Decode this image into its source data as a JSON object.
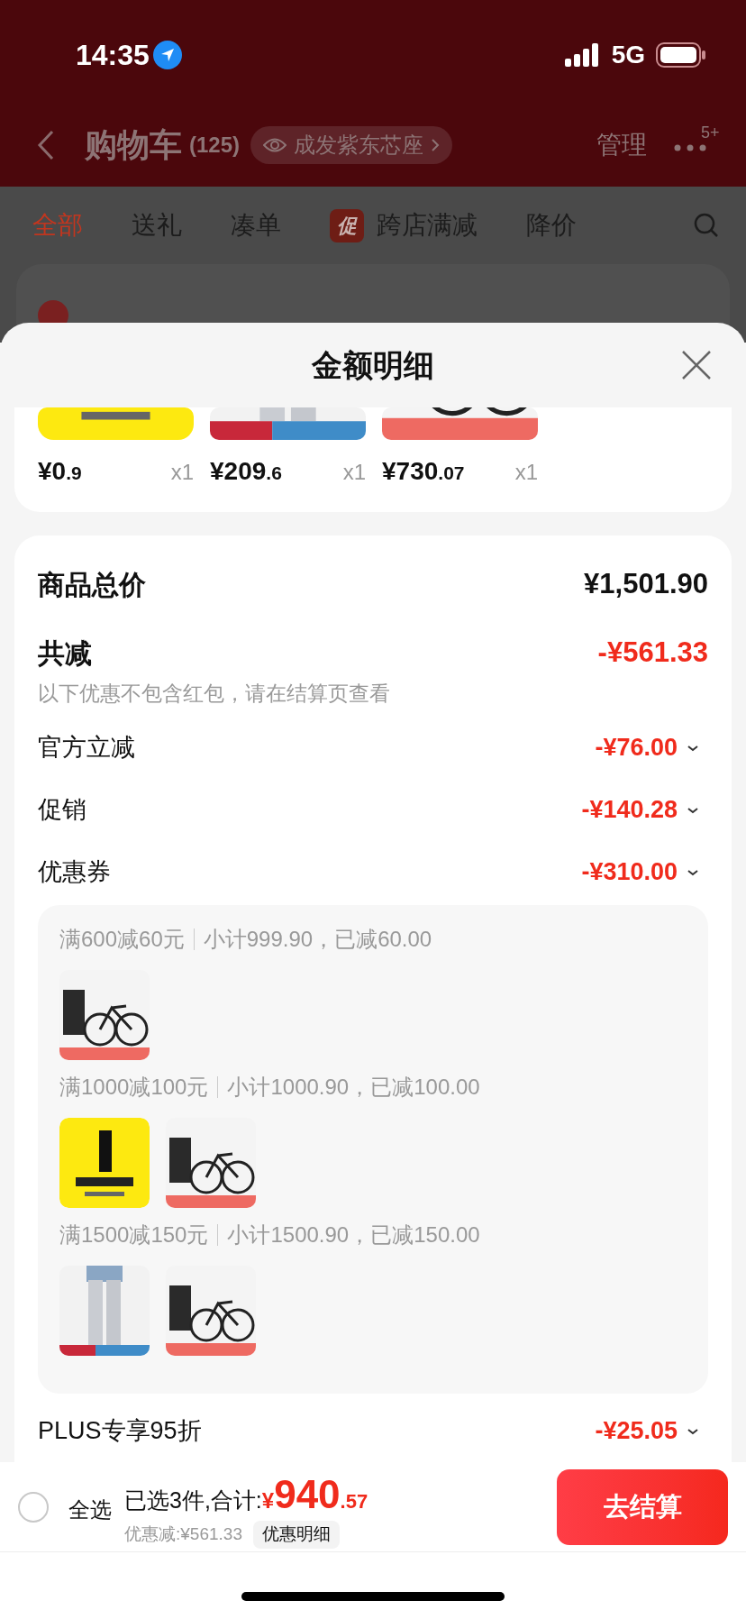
{
  "status_bar": {
    "time": "14:35",
    "network": "5G"
  },
  "nav": {
    "title": "购物车",
    "count": "(125)",
    "location": "成发紫东芯座",
    "manage": "管理",
    "badge": "5+"
  },
  "tabs": [
    {
      "label": "全部",
      "selected": true
    },
    {
      "label": "送礼",
      "selected": false
    },
    {
      "label": "凑单",
      "selected": false
    },
    {
      "label": "跨店满减",
      "selected": false,
      "tag": "促"
    },
    {
      "label": "降价",
      "selected": false
    }
  ],
  "sheet": {
    "title": "金额明细",
    "items": [
      {
        "kind": "postage",
        "currency": "¥",
        "integer": "0",
        "decimal": ".9",
        "qty": "x1"
      },
      {
        "kind": "pants",
        "currency": "¥",
        "integer": "209",
        "decimal": ".6",
        "qty": "x1"
      },
      {
        "kind": "bike",
        "currency": "¥",
        "integer": "730",
        "decimal": ".07",
        "qty": "x1"
      }
    ],
    "total": {
      "label": "商品总价",
      "value": "¥1,501.90"
    },
    "reduction": {
      "label": "共减",
      "value": "-¥561.33",
      "note": "以下优惠不包含红包，请在结算页查看"
    },
    "discounts": [
      {
        "label": "官方立减",
        "value": "-¥76.00"
      },
      {
        "label": "促销",
        "value": "-¥140.28"
      },
      {
        "label": "优惠券",
        "value": "-¥310.00"
      }
    ],
    "coupon_groups": [
      {
        "rule": "满600减60元",
        "detail": "小计999.90，已减60.00",
        "products": [
          {
            "kind": "bike"
          }
        ]
      },
      {
        "rule": "满1000减100元",
        "detail": "小计1000.90，已减100.00",
        "products": [
          {
            "kind": "postage"
          },
          {
            "kind": "bike"
          }
        ]
      },
      {
        "rule": "满1500减150元",
        "detail": "小计1500.90，已减150.00",
        "products": [
          {
            "kind": "pants"
          },
          {
            "kind": "bike"
          }
        ]
      }
    ],
    "plus": {
      "label": "PLUS专享95折",
      "value": "-¥25.05"
    }
  },
  "bottom_bar": {
    "select_all": {
      "label": "全选",
      "checked": false
    },
    "selected_text": "已选3件,合计:",
    "currency": "¥",
    "integer": "940",
    "decimal": ".57",
    "saved": "优惠减:¥561.33",
    "detail_button": "优惠明细",
    "checkout": "去结算"
  }
}
